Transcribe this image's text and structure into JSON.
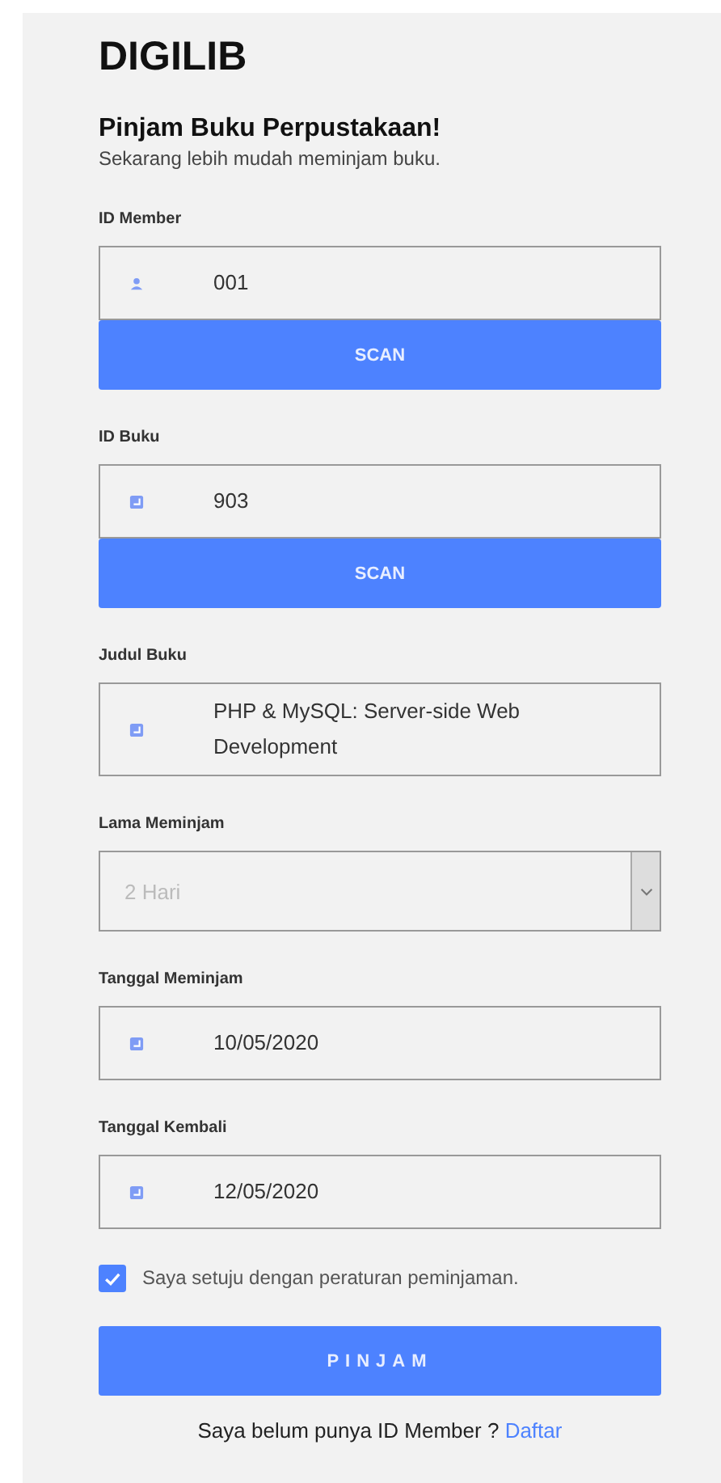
{
  "brand": "DIGILIB",
  "title": "Pinjam Buku Perpustakaan!",
  "subtitle": "Sekarang lebih mudah meminjam buku.",
  "fields": [
    {
      "label": "ID Member",
      "kind": "input",
      "value": "001",
      "button": "SCAN"
    },
    {
      "label": "ID Buku",
      "kind": "input",
      "value": "903",
      "button": "SCAN"
    },
    {
      "label": "Judul Buku",
      "kind": "input",
      "value": "PHP & MySQL: Server-side Web Development"
    },
    {
      "label": "Lama Meminjam",
      "kind": "select",
      "placeholder": "2 Hari"
    },
    {
      "label": "Tanggal Meminjam",
      "kind": "input",
      "value": "10/05/2020"
    },
    {
      "label": "Tanggal Kembali",
      "kind": "input",
      "value": "12/05/2020"
    }
  ],
  "agreement": {
    "label": "Saya setuju dengan peraturan peminjaman.",
    "checked": true
  },
  "submit": "PINJAM",
  "footer": {
    "text": "Saya belum punya ID Member ?",
    "link": "Daftar"
  }
}
